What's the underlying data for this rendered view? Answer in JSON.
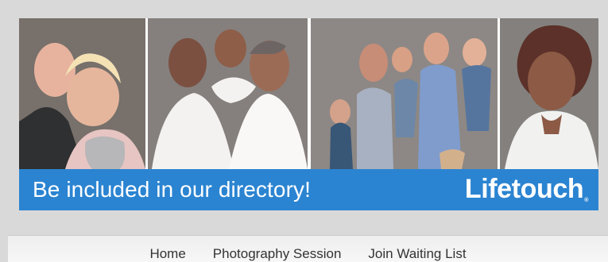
{
  "banner": {
    "photos": [
      {
        "semantic": "couple-portrait"
      },
      {
        "semantic": "family-portrait-three-adults"
      },
      {
        "semantic": "family-portrait-parents-and-children"
      },
      {
        "semantic": "woman-portrait"
      }
    ],
    "headline": "Be included in our directory!",
    "brand": "Lifetouch",
    "brand_mark": "®"
  },
  "nav": {
    "items": [
      {
        "label": "Home"
      },
      {
        "label": "Photography Session"
      },
      {
        "label": "Join Waiting List"
      }
    ]
  },
  "colors": {
    "banner_blue": "#2b84d1",
    "page_bg": "#d9d9d9",
    "nav_bg": "#f3f3f3",
    "text": "#333333"
  }
}
